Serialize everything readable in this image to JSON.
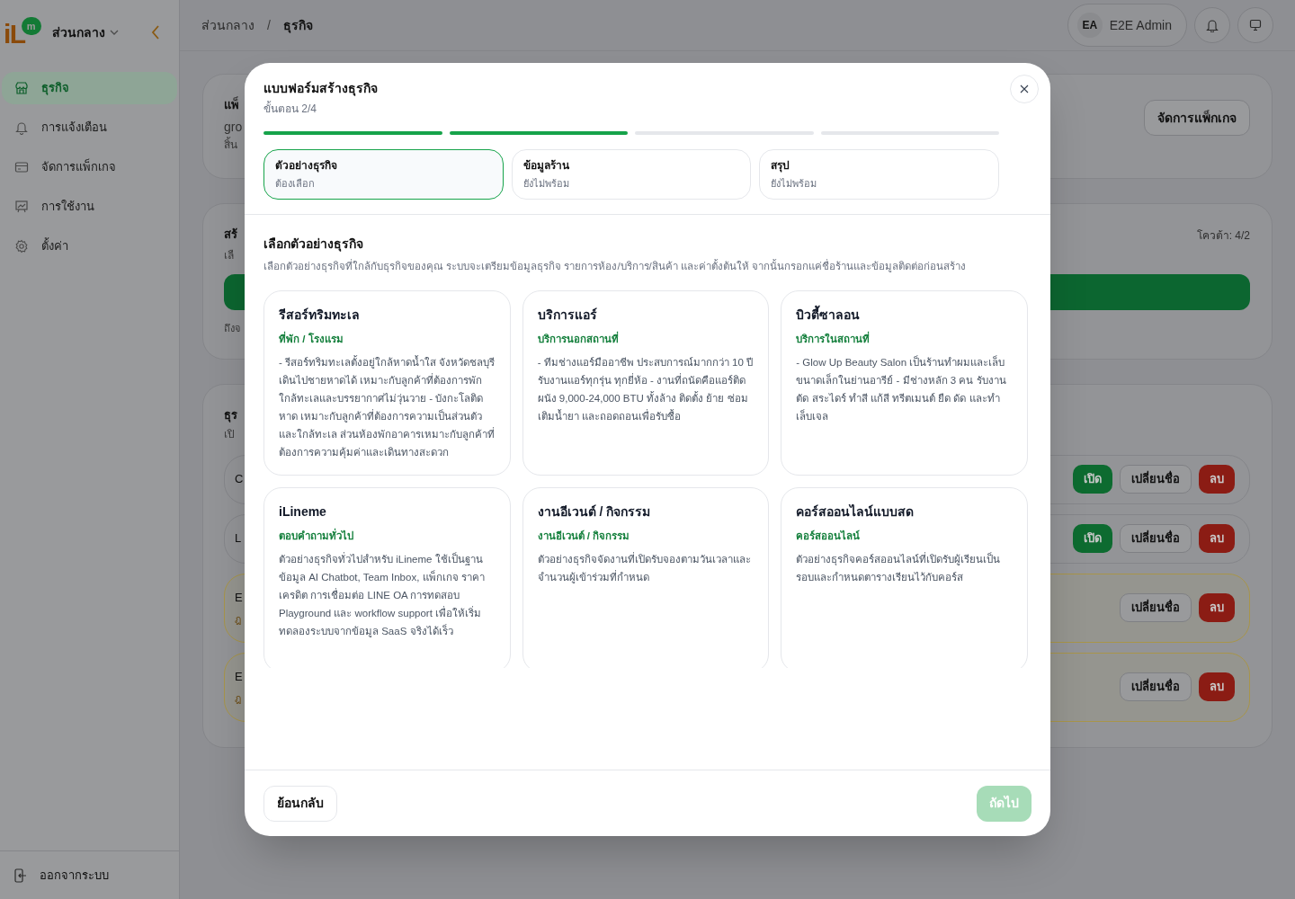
{
  "logo": {
    "letters": "iL",
    "badge": "m"
  },
  "workspace": {
    "label": "ส่วนกลาง"
  },
  "sidebar": {
    "items": [
      {
        "label": "ธุรกิจ",
        "selected": true
      },
      {
        "label": "การแจ้งเตือน",
        "selected": false
      },
      {
        "label": "จัดการแพ็กเกจ",
        "selected": false
      },
      {
        "label": "การใช้งาน",
        "selected": false
      },
      {
        "label": "ตั้งค่า",
        "selected": false
      }
    ],
    "logout": "ออกจากระบบ"
  },
  "breadcrumb": {
    "items": [
      "ส่วนกลาง",
      "ธุรกิจ"
    ],
    "separator": "/"
  },
  "user": {
    "initials": "EA",
    "name": "E2E Admin"
  },
  "background": {
    "package_card": {
      "title": "แพ็",
      "line_1": "gro",
      "line_2": "สิ้น",
      "button": "จัดการแพ็กเกจ"
    },
    "create_card": {
      "title": "สร้",
      "subtitle": "เลื",
      "quota": "โควต้า: 4/2",
      "note": "ถึงจ"
    },
    "business_card": {
      "title": "ธุร",
      "subtitle": "เปิ",
      "rows": [
        {
          "name": "C",
          "warning": false,
          "buttons": [
            {
              "kind": "open",
              "label": "เปิด"
            },
            {
              "kind": "rename",
              "label": "เปลี่ยนชื่อ"
            },
            {
              "kind": "delete",
              "label": "ลบ"
            }
          ]
        },
        {
          "name": "L",
          "warning": false,
          "buttons": [
            {
              "kind": "open",
              "label": "เปิด"
            },
            {
              "kind": "rename",
              "label": "เปลี่ยนชื่อ"
            },
            {
              "kind": "delete",
              "label": "ลบ"
            }
          ]
        },
        {
          "name": "E",
          "sub": "ฎ",
          "warning": true,
          "buttons": [
            {
              "kind": "rename",
              "label": "เปลี่ยนชื่อ"
            },
            {
              "kind": "delete",
              "label": "ลบ"
            }
          ]
        },
        {
          "name": "E",
          "sub": "ฎ",
          "warning": true,
          "buttons": [
            {
              "kind": "rename",
              "label": "เปลี่ยนชื่อ"
            },
            {
              "kind": "delete",
              "label": "ลบ"
            }
          ]
        }
      ]
    }
  },
  "modal": {
    "title": "แบบฟอร์มสร้างธุรกิจ",
    "step_text": "ขั้นตอน 2/4",
    "progress": [
      {
        "done": true
      },
      {
        "done": true
      },
      {
        "done": false
      },
      {
        "done": false
      }
    ],
    "steps": [
      {
        "title": "ตัวอย่างธุรกิจ",
        "status": "ต้องเลือก",
        "selected": true
      },
      {
        "title": "ข้อมูลร้าน",
        "status": "ยังไม่พร้อม",
        "selected": false
      },
      {
        "title": "สรุป",
        "status": "ยังไม่พร้อม",
        "selected": false
      }
    ],
    "section_title": "เลือกตัวอย่างธุรกิจ",
    "section_desc": "เลือกตัวอย่างธุรกิจที่ใกล้กับธุรกิจของคุณ ระบบจะเตรียมข้อมูลธุรกิจ รายการห้อง/บริการ/สินค้า และค่าตั้งต้นให้ จากนั้นกรอกแค่ชื่อร้านและข้อมูลติดต่อก่อนสร้าง",
    "templates": [
      {
        "title": "รีสอร์ทริมทะเล",
        "category": "ที่พัก / โรงแรม",
        "description": "- รีสอร์ทริมทะเลตั้งอยู่ใกล้หาดน้ำใส จังหวัดชลบุรี เดินไปชายหาดได้ เหมาะกับลูกค้าที่ต้องการพักใกล้ทะเลและบรรยากาศไม่วุ่นวาย - บังกะโลติดหาด เหมาะกับลูกค้าที่ต้องการความเป็นส่วนตัวและใกล้ทะเล ส่วนห้องพักอาคารเหมาะกับลูกค้าที่ต้องการความคุ้มค่าและเดินทางสะดวก",
        "selected": false
      },
      {
        "title": "บริการแอร์",
        "category": "บริการนอกสถานที่",
        "description": "- ทีมช่างแอร์มืออาชีพ ประสบการณ์มากกว่า 10 ปี รับงานแอร์ทุกรุ่น ทุกยี่ห้อ - งานที่ถนัดคือแอร์ติดผนัง 9,000-24,000 BTU ทั้งล้าง ติดตั้ง ย้าย ซ่อม เติมน้ำยา และถอดถอนเพื่อรับซื้อ",
        "selected": false
      },
      {
        "title": "บิวตี้ซาลอน",
        "category": "บริการในสถานที่",
        "description": "- Glow Up Beauty Salon เป็นร้านทำผมและเล็บขนาดเล็กในย่านอารีย์ - มีช่างหลัก 3 คน รับงานตัด สระไดร์ ทำสี แก้สี ทรีตเมนต์ ยืด ดัด และทำเล็บเจล",
        "selected": false
      },
      {
        "title": "iLineme",
        "category": "ตอบคำถามทั่วไป",
        "description": "ตัวอย่างธุรกิจทั่วไปสำหรับ iLineme ใช้เป็นฐานข้อมูล AI Chatbot, Team Inbox, แพ็กเกจ ราคาเครดิต การเชื่อมต่อ LINE OA การทดสอบ Playground และ workflow support เพื่อให้เริ่มทดลองระบบจากข้อมูล SaaS จริงได้เร็ว",
        "selected": false
      },
      {
        "title": "งานอีเวนต์ / กิจกรรม",
        "category": "งานอีเวนต์ / กิจกรรม",
        "description": "ตัวอย่างธุรกิจจัดงานที่เปิดรับจองตามวันเวลาและจำนวนผู้เข้าร่วมที่กำหนด",
        "selected": false
      },
      {
        "title": "คอร์สออนไลน์แบบสด",
        "category": "คอร์สออนไลน์",
        "description": "ตัวอย่างธุรกิจคอร์สออนไลน์ที่เปิดรับผู้เรียนเป็นรอบและกำหนดตารางเรียนไว้กับคอร์ส",
        "selected": false
      }
    ],
    "back_button": "ย้อนกลับ",
    "next_button": {
      "label": "ถัดไป",
      "disabled": true
    }
  }
}
